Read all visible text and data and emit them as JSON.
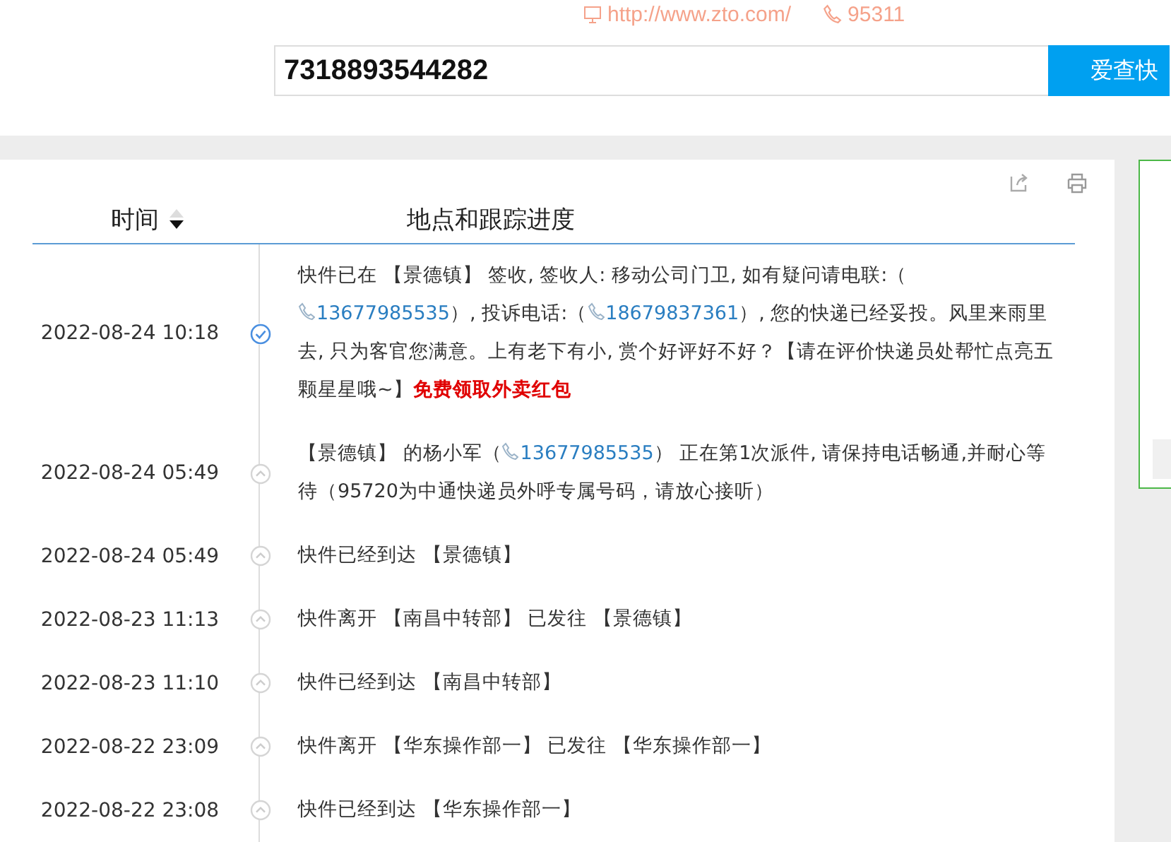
{
  "header": {
    "website": "http://www.zto.com/",
    "hotline": "95311"
  },
  "search": {
    "value": "7318893544282",
    "button": "爱查快"
  },
  "table": {
    "columns": [
      {
        "label": "时间",
        "sortable": true
      },
      {
        "label": "地点和跟踪进度"
      }
    ],
    "events": [
      {
        "time": "2022-08-24 10:18",
        "delivered": true,
        "parts": [
          {
            "kind": "text",
            "text": "快件已在 【景德镇】 签收, 签收人: 移动公司门卫, 如有疑问请电联:（"
          },
          {
            "kind": "phone",
            "text": "13677985535"
          },
          {
            "kind": "text",
            "text": "）, 投诉电话:（"
          },
          {
            "kind": "phone",
            "text": "18679837361"
          },
          {
            "kind": "text",
            "text": "）, 您的快递已经妥投。风里来雨里去, 只为客官您满意。上有老下有小, 赏个好评好不好？【请在评价快递员处帮忙点亮五颗星星哦~】"
          },
          {
            "kind": "promo",
            "text": "免费领取外卖红包"
          }
        ]
      },
      {
        "time": "2022-08-24 05:49",
        "delivered": false,
        "parts": [
          {
            "kind": "text",
            "text": "【景德镇】 的杨小军（"
          },
          {
            "kind": "phone",
            "text": "13677985535"
          },
          {
            "kind": "text",
            "text": "） 正在第1次派件, 请保持电话畅通,并耐心等待（95720为中通快递员外呼专属号码，请放心接听）"
          }
        ]
      },
      {
        "time": "2022-08-24 05:49",
        "delivered": false,
        "parts": [
          {
            "kind": "text",
            "text": "快件已经到达 【景德镇】"
          }
        ]
      },
      {
        "time": "2022-08-23 11:13",
        "delivered": false,
        "parts": [
          {
            "kind": "text",
            "text": "快件离开 【南昌中转部】 已发往 【景德镇】"
          }
        ]
      },
      {
        "time": "2022-08-23 11:10",
        "delivered": false,
        "parts": [
          {
            "kind": "text",
            "text": "快件已经到达 【南昌中转部】"
          }
        ]
      },
      {
        "time": "2022-08-22 23:09",
        "delivered": false,
        "parts": [
          {
            "kind": "text",
            "text": "快件离开 【华东操作部一】 已发往 【华东操作部一】"
          }
        ]
      },
      {
        "time": "2022-08-22 23:08",
        "delivered": false,
        "parts": [
          {
            "kind": "text",
            "text": "快件已经到达 【华东操作部一】"
          }
        ]
      }
    ]
  }
}
